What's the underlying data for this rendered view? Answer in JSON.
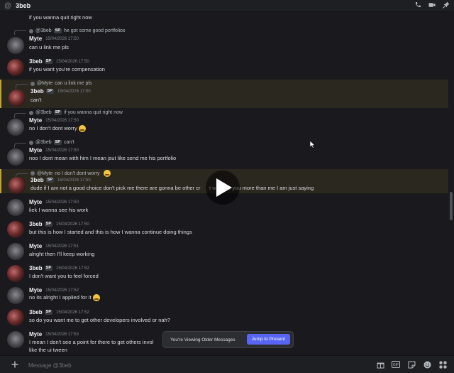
{
  "header": {
    "at": "@",
    "title": "3beb"
  },
  "composer": {
    "placeholder": "Message @3beb"
  },
  "banner": {
    "label": "You're Viewing Older Messages",
    "button": "Jump to Present"
  },
  "messages": [
    {
      "author": "",
      "badge": "",
      "time": "",
      "text": "if you wanna quit right now"
    },
    {
      "reply_author": "@3beb",
      "reply_badge": "SP",
      "reply_text": "he got some good portfolios",
      "author": "Myte",
      "badge": "",
      "time": "15/04/2026 17:50",
      "text": "can u link me pls"
    },
    {
      "author": "3beb",
      "badge": "SP",
      "time": "15/04/2026 17:50",
      "text": "if you want you're compensation"
    },
    {
      "reply_author": "@Myte",
      "reply_badge": "",
      "reply_text": "can u link me pls",
      "author": "3beb",
      "badge": "SP",
      "time": "15/04/2026 17:50",
      "text": "can't"
    },
    {
      "reply_author": "@3beb",
      "reply_badge": "SP",
      "reply_text": "if you wanna quit right now",
      "author": "Myte",
      "badge": "",
      "time": "15/04/2026 17:50",
      "text": "no I don't dont worry"
    },
    {
      "reply_author": "@3beb",
      "reply_badge": "SP",
      "reply_text": "can't",
      "author": "Myte",
      "badge": "",
      "time": "15/04/2026 17:50",
      "text": "noo I dont mean with him I mean jsut like send me his portfolio"
    },
    {
      "reply_author": "@Myte",
      "reply_badge": "",
      "reply_text": "no I don't dont worry",
      "author": "3beb",
      "badge": "SP",
      "time": "15/04/2026 17:50",
      "text": "dude if I am not a good choice don't pick me there are gonna be other cr      t will give you more than me I am just saying"
    },
    {
      "author": "Myte",
      "badge": "",
      "time": "15/04/2026 17:50",
      "text": "liek I wanna see his work"
    },
    {
      "author": "3beb",
      "badge": "SP",
      "time": "15/04/2026 17:50",
      "text": "but this is how I started and this is how I wanna continue doing things"
    },
    {
      "author": "Myte",
      "badge": "",
      "time": "15/04/2026 17:51",
      "text": "alright then I'll keep working"
    },
    {
      "author": "3beb",
      "badge": "SP",
      "time": "15/04/2026 17:52",
      "text": "I don't want you to feel forced"
    },
    {
      "author": "Myte",
      "badge": "",
      "time": "15/04/2026 17:52",
      "text": "no its alright I applied for it"
    },
    {
      "author": "3beb",
      "badge": "SP",
      "time": "15/04/2026 17:52",
      "text": "so do you want me to get other developers involved or nah?"
    },
    {
      "author": "Myte",
      "badge": "",
      "time": "15/04/2026 17:53",
      "text": "I mean I don't see a point for there to get others invol",
      "text2": "like the ui tween"
    }
  ]
}
